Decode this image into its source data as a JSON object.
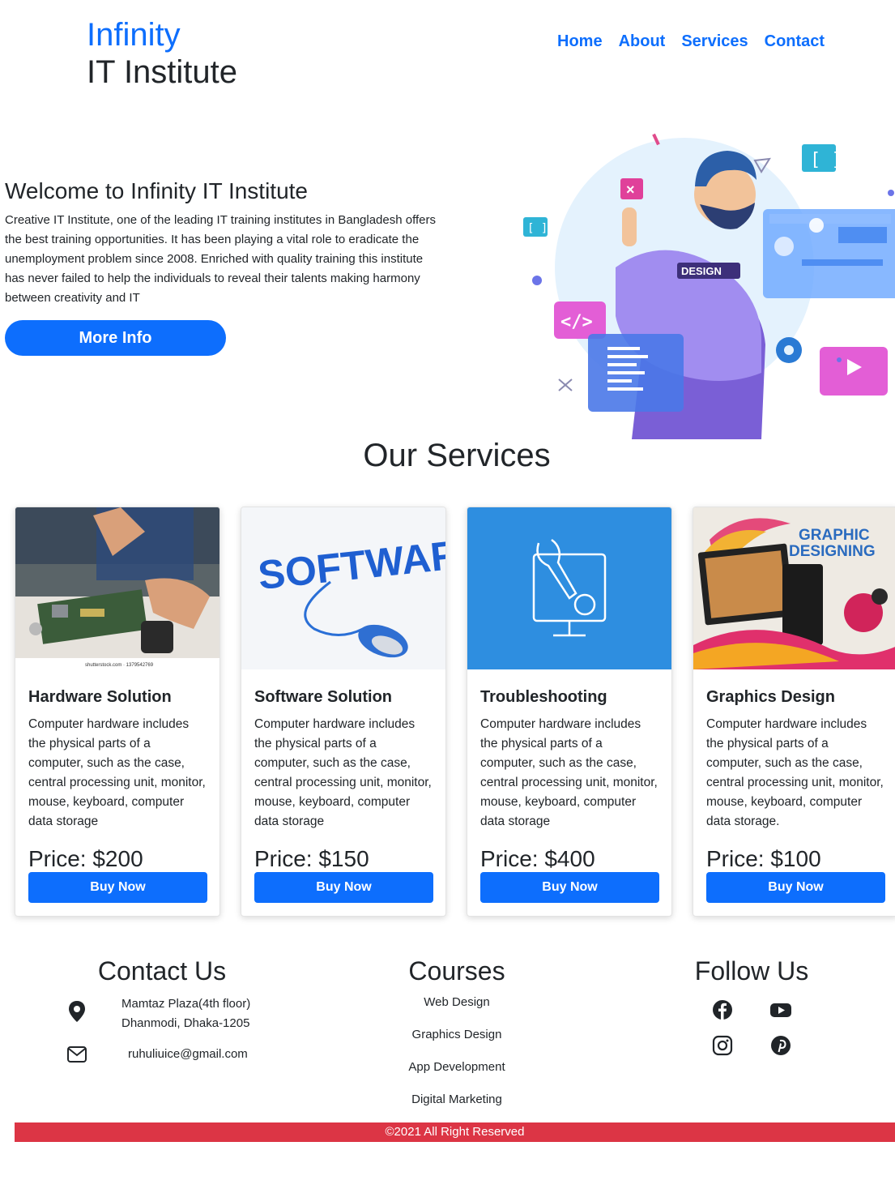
{
  "brand": {
    "line1": "Infinity",
    "line2": "IT Institute"
  },
  "nav": {
    "items": [
      "Home",
      "About",
      "Services",
      "Contact"
    ]
  },
  "hero": {
    "title": "Welcome to Infinity IT Institute",
    "description": "Creative IT Institute, one of the leading IT training institutes in Bangladesh offers the best training opportunities. It has been playing a vital role to eradicate the unemployment problem since 2008. Enriched with quality training this institute has never failed to help the individuals to reveal their talents making harmony between creativity and IT",
    "button": "More Info",
    "art_badge": "DESIGN"
  },
  "services": {
    "title": "Our Services",
    "cards": [
      {
        "title": "Hardware Solution",
        "text": "Computer hardware includes the physical parts of a computer, such as the case, central processing unit, monitor, mouse, keyboard, computer data storage",
        "price": "Price: $200",
        "button": "Buy Now",
        "image_caption": "shutterstock.com · 1379542769"
      },
      {
        "title": "Software Solution",
        "text": "Computer hardware includes the physical parts of a computer, such as the case, central processing unit, monitor, mouse, keyboard, computer data storage",
        "price": "Price: $150",
        "button": "Buy Now",
        "image_word": "SOFTWARE"
      },
      {
        "title": "Troubleshooting",
        "text": "Computer hardware includes the physical parts of a computer, such as the case, central processing unit, monitor, mouse, keyboard, computer data storage",
        "price": "Price: $400",
        "button": "Buy Now"
      },
      {
        "title": "Graphics Design",
        "text": "Computer hardware includes the physical parts of a computer, such as the case, central processing unit, monitor, mouse, keyboard, computer data storage.",
        "price": "Price: $100",
        "button": "Buy Now",
        "image_word1": "GRAPHIC",
        "image_word2": "DESIGNING"
      }
    ]
  },
  "footer": {
    "contact": {
      "title": "Contact Us",
      "address_line1": "Mamtaz Plaza(4th floor)",
      "address_line2": "Dhanmodi, Dhaka-1205",
      "email": "ruhuliuice@gmail.com"
    },
    "courses": {
      "title": "Courses",
      "items": [
        "Web Design",
        "Graphics Design",
        "App Development",
        "Digital Marketing"
      ]
    },
    "follow": {
      "title": "Follow Us",
      "icons": [
        "facebook-icon",
        "youtube-icon",
        "instagram-icon",
        "pinterest-icon"
      ]
    },
    "copyright": "©2021 All Right Reserved"
  },
  "colors": {
    "primary": "#0d6efd",
    "footer_bar": "#dc3545",
    "text": "#212529"
  }
}
